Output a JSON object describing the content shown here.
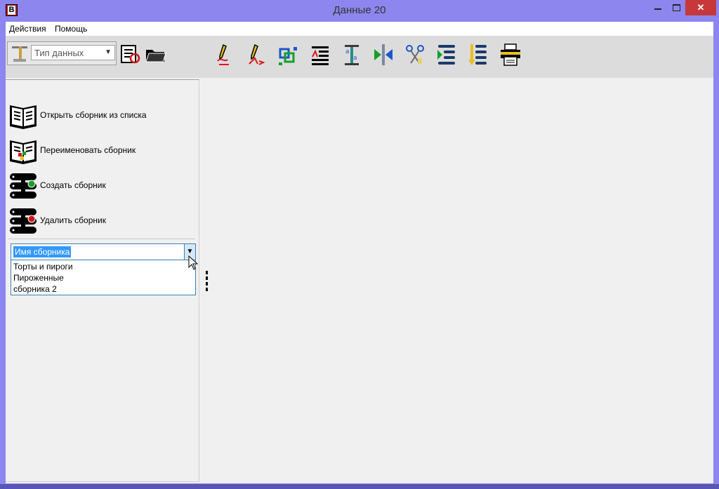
{
  "window": {
    "title": "Данные 20",
    "close_glyph": "✕"
  },
  "menu": {
    "items": [
      {
        "label": "Действия"
      },
      {
        "label": "Помощь"
      }
    ]
  },
  "toolbar": {
    "type_select": {
      "value": "Тип данных"
    },
    "icons": [
      "import-doc-icon",
      "open-folder-icon",
      "pencil-edit-icon",
      "pencil-text-icon",
      "link-squares-icon",
      "list-edit-icon",
      "text-replace-icon",
      "merge-arrows-icon",
      "scissors-icon",
      "list-move-icon",
      "list-sort-icon",
      "printer-icon"
    ]
  },
  "sidebar": {
    "commands": [
      {
        "label": "Открыть сборник из списка",
        "icon": "open-book-icon"
      },
      {
        "label": "Переименовать сборник",
        "icon": "rename-book-icon"
      },
      {
        "label": "Создать сборник",
        "icon": "add-database-icon"
      },
      {
        "label": "Удалить сборник",
        "icon": "delete-database-icon"
      }
    ],
    "collection_combo": {
      "value": "Имя сборника",
      "options": [
        "Торты и пироги",
        "Пироженные",
        "сборника 2"
      ]
    }
  },
  "colors": {
    "titlebar": "#8c86ee",
    "close": "#c7383a",
    "selection": "#3399ff",
    "toolbar": "#dcdcdc"
  }
}
